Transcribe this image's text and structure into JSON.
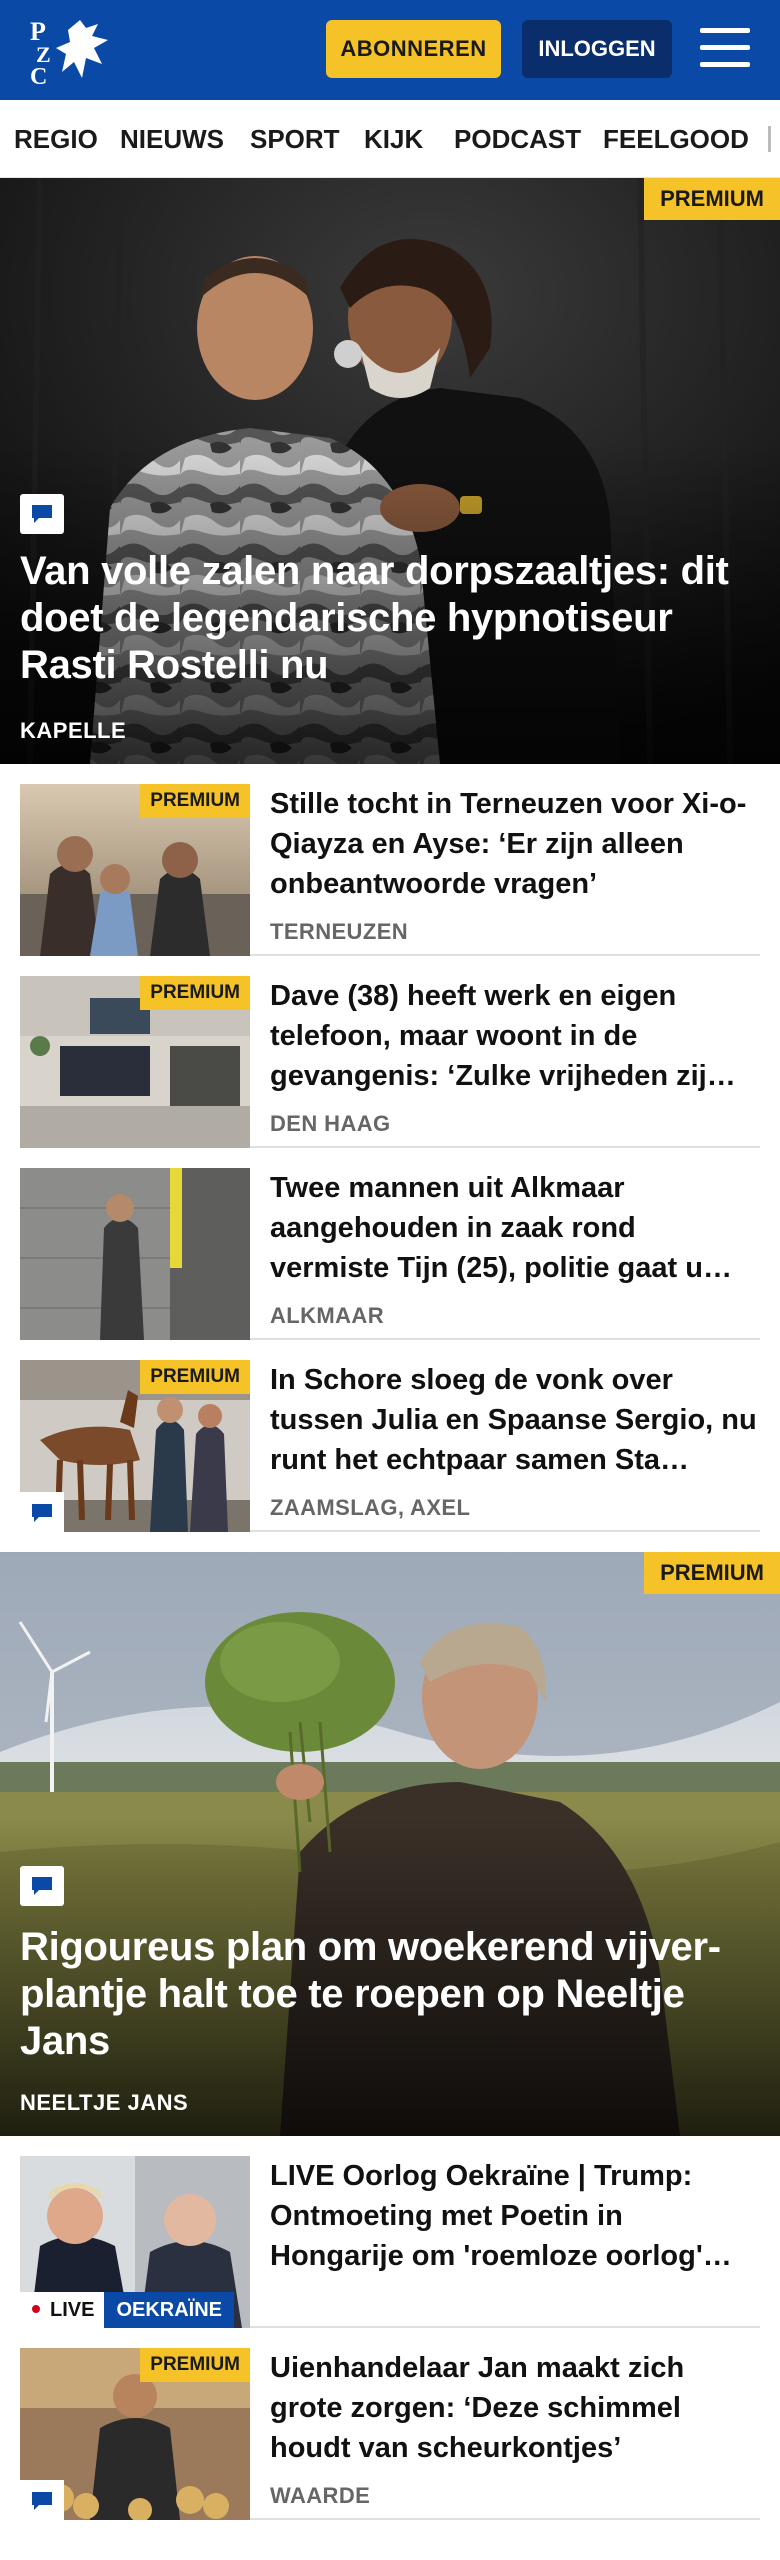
{
  "header": {
    "logo_text": "PZC",
    "subscribe_label": "ABONNEREN",
    "login_label": "INLOGGEN",
    "colors": {
      "brand": "#0a4aa6",
      "accent": "#f5c227",
      "dark": "#0a2e6b"
    }
  },
  "nav": {
    "items": [
      "REGIO",
      "NIEUWS",
      "SPORT",
      "KIJK",
      "PODCAST",
      "FEELGOOD"
    ]
  },
  "hero1": {
    "badge": "PREMIUM",
    "title": "Van volle zalen naar dorpszaaltjes: dit doet de legendarische hypnotiseur Rasti Rostelli nu",
    "location": "KAPELLE",
    "icon": "comment-icon"
  },
  "list1": [
    {
      "title": "Stille tocht in Terneuzen voor Xi-o-Qiayza en Ayse: ‘Er zijn alleen onbeantwoorde vragen’",
      "location": "TERNEUZEN",
      "badge": "PREMIUM"
    },
    {
      "title": "Dave (38) heeft werk en eigen telefoon, maar woont in de gevangenis: ‘Zulke vrijheden zij…",
      "location": "DEN HAAG",
      "badge": "PREMIUM"
    },
    {
      "title": "Twee mannen uit Alkmaar aangehouden in zaak rond vermiste Tijn (25), politie gaat u…",
      "location": "ALKMAAR"
    },
    {
      "title": "In Schore sloeg de vonk over tussen Julia en Spaanse Sergio, nu runt het echtpaar samen Sta…",
      "location": "ZAAMSLAG, AXEL",
      "badge": "PREMIUM"
    }
  ],
  "hero2": {
    "badge": "PREMIUM",
    "title": "Rigoureus plan om woekerend vijver-plantje halt toe te roepen op Neeltje Jans",
    "location": "NEELTJE JANS",
    "icon": "comment-icon"
  },
  "list2": [
    {
      "title": "LIVE Oorlog Oekraïne | Trump: Ontmoeting met Poetin in Hongarije om 'roemloze oorlog'…",
      "live_label": "LIVE",
      "tag": "OEKRAÏNE"
    },
    {
      "title": "Uienhandelaar Jan maakt zich grote zorgen: ‘Deze schimmel houdt van scheurkontjes’",
      "location": "WAARDE",
      "badge": "PREMIUM"
    }
  ]
}
